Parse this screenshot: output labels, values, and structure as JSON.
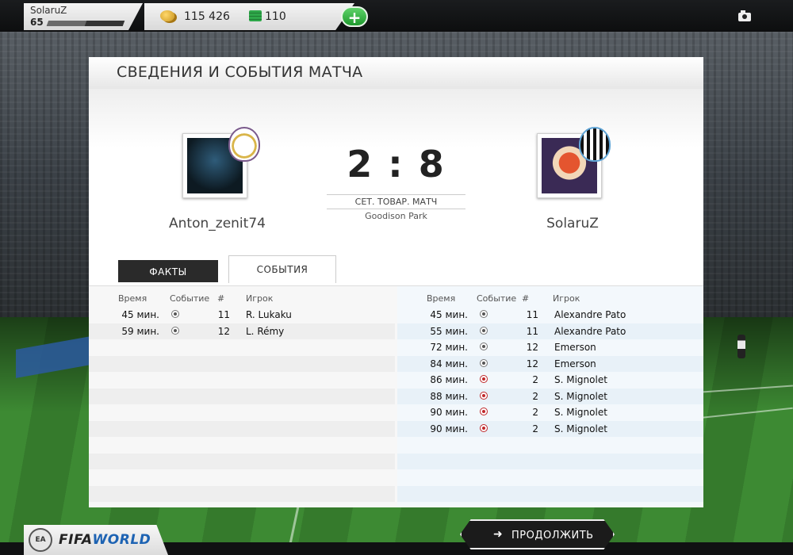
{
  "topbar": {
    "username": "SolaruZ",
    "level": "65",
    "level_progress": 0.5,
    "coins": "115 426",
    "points": "110",
    "add_label": "+",
    "camera_icon": "camera-icon"
  },
  "panel": {
    "title": "СВЕДЕНИЯ И СОБЫТИЯ МАТЧА",
    "home_name": "Anton_zenit74",
    "away_name": "SolaruZ",
    "score": "2 : 8",
    "match_type": "СЕТ. ТОВАР. МАТЧ",
    "venue": "Goodison Park",
    "tabs": [
      "ФАКТЫ",
      "СОБЫТИЯ"
    ],
    "headers": {
      "time": "Время",
      "event": "Событие",
      "num": "#",
      "player": "Игрок"
    }
  },
  "home_events": [
    {
      "time": "45 мин.",
      "type": "goal",
      "num": "11",
      "player": "R. Lukaku"
    },
    {
      "time": "59 мин.",
      "type": "goal",
      "num": "12",
      "player": "L. Rémy"
    }
  ],
  "away_events": [
    {
      "time": "45 мин.",
      "type": "goal",
      "num": "11",
      "player": "Alexandre Pato"
    },
    {
      "time": "55 мин.",
      "type": "goal",
      "num": "11",
      "player": "Alexandre Pato"
    },
    {
      "time": "72 мин.",
      "type": "goal",
      "num": "12",
      "player": "Emerson"
    },
    {
      "time": "84 мин.",
      "type": "goal",
      "num": "12",
      "player": "Emerson"
    },
    {
      "time": "86 мин.",
      "type": "own-goal",
      "num": "2",
      "player": "S. Mignolet"
    },
    {
      "time": "88 мин.",
      "type": "own-goal",
      "num": "2",
      "player": "S. Mignolet"
    },
    {
      "time": "90 мин.",
      "type": "own-goal",
      "num": "2",
      "player": "S. Mignolet"
    },
    {
      "time": "90 мин.",
      "type": "own-goal",
      "num": "2",
      "player": "S. Mignolet"
    }
  ],
  "footer": {
    "ea_label": "EA",
    "logo_prefix": "FIFA",
    "logo_suffix": "WORLD",
    "continue_label": "ПРОДОЛЖИТЬ"
  },
  "colors": {
    "accent_green": "#1f9a2e",
    "own_goal_red": "#c0282b",
    "brand_blue": "#1d63b3"
  }
}
